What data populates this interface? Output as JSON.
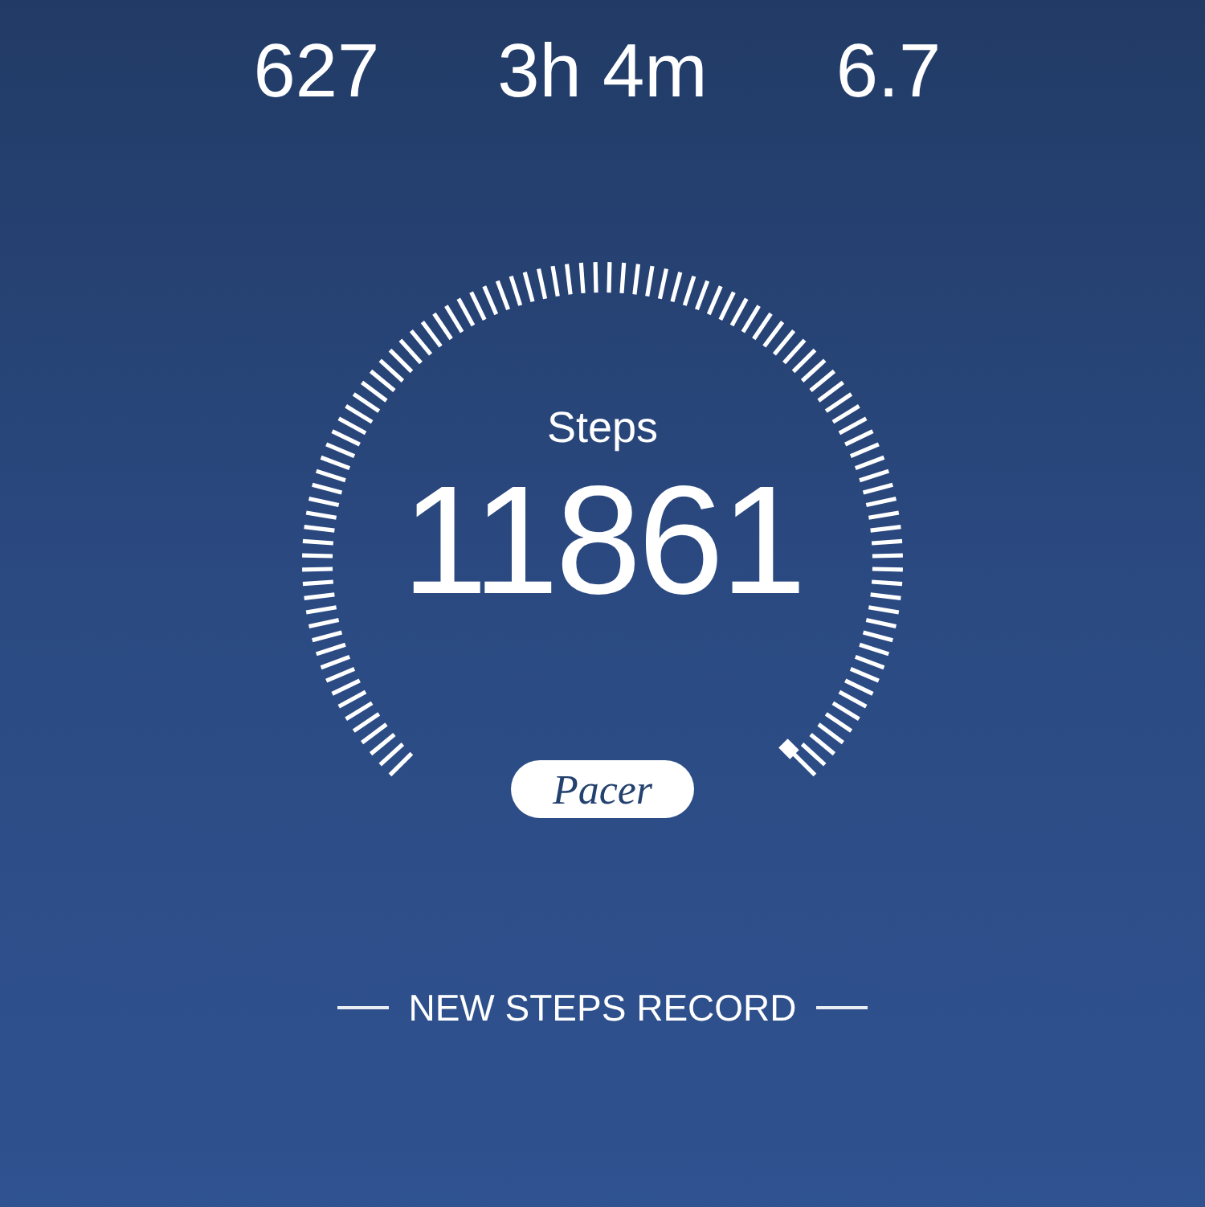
{
  "stats": [
    {
      "value": "627"
    },
    {
      "value": "3h 4m"
    },
    {
      "value": "6.7"
    }
  ],
  "gauge": {
    "label": "Steps",
    "value": "11861"
  },
  "logo": "Pacer",
  "banner": "NEW STEPS RECORD"
}
